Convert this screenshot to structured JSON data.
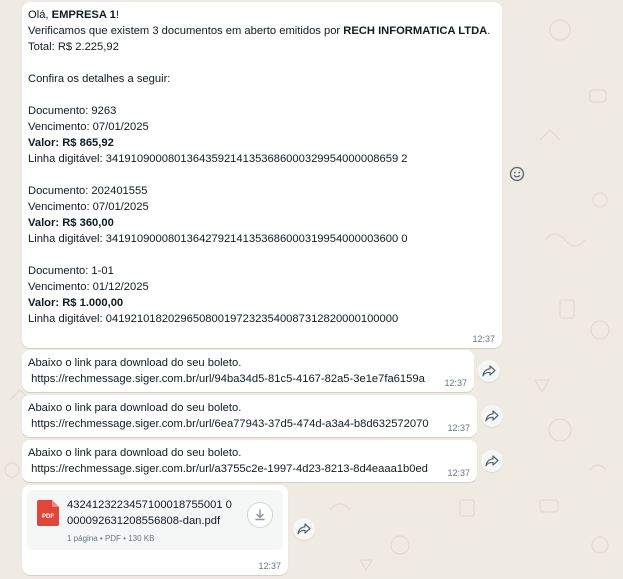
{
  "colors": {
    "background": "#efeae2",
    "bubble": "#ffffff",
    "meta_text": "#667781",
    "pdf_red": "#e2463a"
  },
  "message_main": {
    "greeting_prefix": "Olá, ",
    "greeting_name": "EMPRESA 1",
    "greeting_suffix": "!",
    "intro_prefix": "Verificamos que existem 3 documentos em aberto emitidos por ",
    "intro_company": "RECH INFORMATICA LTDA",
    "intro_suffix": ".",
    "total": "Total: R$ 2.225,92",
    "details_heading": "Confira os detalhes a seguir:",
    "documents": [
      {
        "documento": "Documento: 9263",
        "vencimento": "Vencimento: 07/01/2025",
        "valor": "Valor: R$ 865,92",
        "linha": "Linha digitável: 34191090008013643592141353686000329954000008659 2"
      },
      {
        "documento": "Documento: 202401555",
        "vencimento": "Vencimento: 07/01/2025",
        "valor": "Valor: R$ 360,00",
        "linha": "Linha digitável: 34191090008013642792141353686000319954000003600 0"
      },
      {
        "documento": "Documento: 1-01",
        "vencimento": "Vencimento: 01/12/2025",
        "valor": "Valor: R$ 1.000,00",
        "linha": "Linha digitável: 04192101820296508001972323540087312820000100000"
      }
    ],
    "time": "12:37"
  },
  "link_messages": [
    {
      "text": "Abaixo o link para download do seu boleto.",
      "url": " https://rechmessage.siger.com.br/url/94ba34d5-81c5-4167-82a5-3e1e7fa6159a",
      "time": "12:37"
    },
    {
      "text": "Abaixo o link para download do seu boleto.",
      "url": " https://rechmessage.siger.com.br/url/6ea77943-37d5-474d-a3a4-b8d632572070",
      "time": "12:37"
    },
    {
      "text": "Abaixo o link para download do seu boleto.",
      "url": " https://rechmessage.siger.com.br/url/a3755c2e-1997-4d23-8213-8d4eaaa1b0ed",
      "time": "12:37"
    }
  ],
  "file_message": {
    "icon_label": "PDF",
    "file_name_line1": "4324123223457100018755001 0",
    "file_name_line2": "000092631208556808-dan.pdf",
    "meta": "1 página • PDF • 130 KB",
    "time": "12:37"
  },
  "icons": {
    "react": "emoji-smile-icon",
    "forward": "forward-arrow-icon",
    "download": "download-arrow-icon",
    "file": "pdf-file-icon"
  }
}
